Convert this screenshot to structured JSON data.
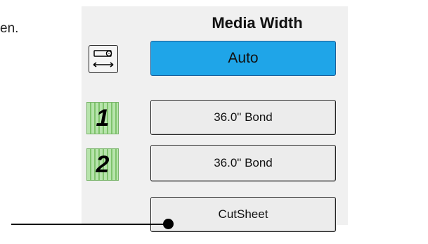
{
  "left_text": "en.",
  "panel": {
    "title": "Media Width",
    "buttons": {
      "auto": "Auto",
      "roll1": "36.0\" Bond",
      "roll2": "36.0\" Bond",
      "cutsheet": "CutSheet"
    },
    "roll_badges": [
      "1",
      "2"
    ]
  },
  "icons": {
    "width_icon": "media-width-icon",
    "roll_icon": "roll-icon",
    "callout": "callout-pointer"
  },
  "colors": {
    "auto_active": "#1fa5e8",
    "roll_green": "#9ed68f"
  }
}
